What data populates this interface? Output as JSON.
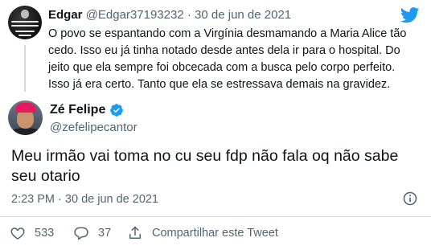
{
  "reply_tweet": {
    "display_name": "Edgar",
    "handle": "@Edgar37193232",
    "separator": "·",
    "date": "30 de jun de 2021",
    "text": "O povo se espantando com a Virgínia desmamando a Maria Alice tão cedo. Isso eu já tinha notado desde antes dela ir para o hospital. Do jeito que ela sempre foi obcecada com a busca pelo corpo perfeito. Isso já era certo. Tanto que ela se estressava demais na gravidez."
  },
  "main_tweet": {
    "display_name": "Zé Felipe",
    "handle": "@zefelipecantor",
    "text": "Meu irmão vai toma no cu seu fdp não fala oq não sabe seu otario",
    "time": "2:23 PM",
    "separator": "·",
    "date": "30 de jun de 2021"
  },
  "actions": {
    "like_count": "533",
    "reply_count": "37",
    "share_label": "Compartilhar este Tweet"
  },
  "icons": {
    "logo": "twitter-bird-icon",
    "verified": "verified-badge-icon",
    "info": "info-icon",
    "like": "heart-icon",
    "reply": "reply-bubble-icon",
    "share": "share-icon"
  },
  "colors": {
    "brand": "#1d9bf0",
    "text": "#0f1419",
    "muted": "#536471",
    "divider": "#cfd9de"
  }
}
